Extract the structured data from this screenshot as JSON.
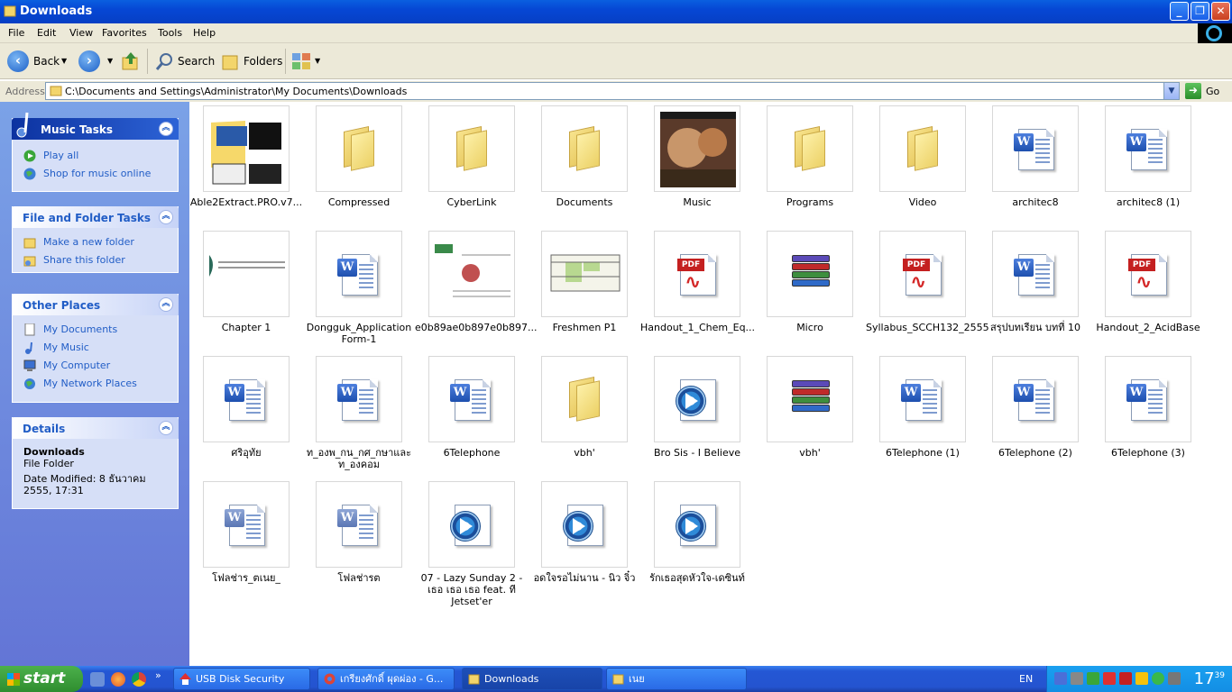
{
  "window": {
    "title": "Downloads"
  },
  "menu": [
    "File",
    "Edit",
    "View",
    "Favorites",
    "Tools",
    "Help"
  ],
  "toolbar": {
    "back": "Back",
    "search": "Search",
    "folders": "Folders"
  },
  "address": {
    "label": "Address",
    "path": "C:\\Documents and Settings\\Administrator\\My Documents\\Downloads",
    "go": "Go"
  },
  "panels": {
    "music": {
      "title": "Music Tasks",
      "items": [
        "Play all",
        "Shop for music online"
      ]
    },
    "file": {
      "title": "File and Folder Tasks",
      "items": [
        "Make a new folder",
        "Share this folder"
      ]
    },
    "other": {
      "title": "Other Places",
      "items": [
        "My Documents",
        "My Music",
        "My Computer",
        "My Network Places"
      ]
    },
    "details": {
      "title": "Details",
      "name": "Downloads",
      "type": "File Folder",
      "modified": "Date Modified: 8 ธันวาคม 2555, 17:31"
    }
  },
  "files": [
    {
      "name": "Able2Extract.PRO.v7...",
      "kind": "image"
    },
    {
      "name": "Compressed",
      "kind": "folder"
    },
    {
      "name": "CyberLink",
      "kind": "folder"
    },
    {
      "name": "Documents",
      "kind": "folder"
    },
    {
      "name": "Music",
      "kind": "photo"
    },
    {
      "name": "Programs",
      "kind": "folder"
    },
    {
      "name": "Video",
      "kind": "folder"
    },
    {
      "name": "architec8",
      "kind": "word"
    },
    {
      "name": "architec8 (1)",
      "kind": "word"
    },
    {
      "name": "Chapter 1",
      "kind": "docpreview"
    },
    {
      "name": "Dongguk_Application Form-1",
      "kind": "word"
    },
    {
      "name": "e0b89ae0b897e0b897...",
      "kind": "docpreview2"
    },
    {
      "name": "Freshmen P1",
      "kind": "table"
    },
    {
      "name": "Handout_1_Chem_Eq...",
      "kind": "pdf"
    },
    {
      "name": "Micro",
      "kind": "rar"
    },
    {
      "name": "Syllabus_SCCH132_2555",
      "kind": "pdf"
    },
    {
      "name": "สรุปบทเรียน บทที่ 10",
      "kind": "word"
    },
    {
      "name": "Handout_2_AcidBase",
      "kind": "pdf"
    },
    {
      "name": "ศริอุทัย",
      "kind": "word"
    },
    {
      "name": "ท_องพ_กน_กศ_กษาและท_องคอม",
      "kind": "word"
    },
    {
      "name": "6Telephone",
      "kind": "word"
    },
    {
      "name": "vbh'",
      "kind": "folder"
    },
    {
      "name": "Bro Sis - I Believe",
      "kind": "media"
    },
    {
      "name": "vbh'",
      "kind": "rar"
    },
    {
      "name": "6Telephone (1)",
      "kind": "word"
    },
    {
      "name": "6Telephone (2)",
      "kind": "word"
    },
    {
      "name": "6Telephone (3)",
      "kind": "word"
    },
    {
      "name": "โฟลช่าร_ตเนย_",
      "kind": "word2"
    },
    {
      "name": "โฟลช่ารต",
      "kind": "word2"
    },
    {
      "name": "07 - Lazy Sunday 2 - เธอ เธอ เธอ feat. ที Jetset'er",
      "kind": "media"
    },
    {
      "name": "อดใจรอไม่นาน - นิว จิ๋ว",
      "kind": "media"
    },
    {
      "name": "รักเธอสุดหัวใจ-เดซินท์",
      "kind": "media"
    }
  ],
  "taskbar": {
    "start": "start",
    "buttons": [
      "USB Disk Security",
      "เกรียงศักดิ์ ผุดผ่อง - G...",
      "Downloads",
      "เนย"
    ],
    "lang": "EN",
    "time": "17",
    "time_min": "39"
  }
}
